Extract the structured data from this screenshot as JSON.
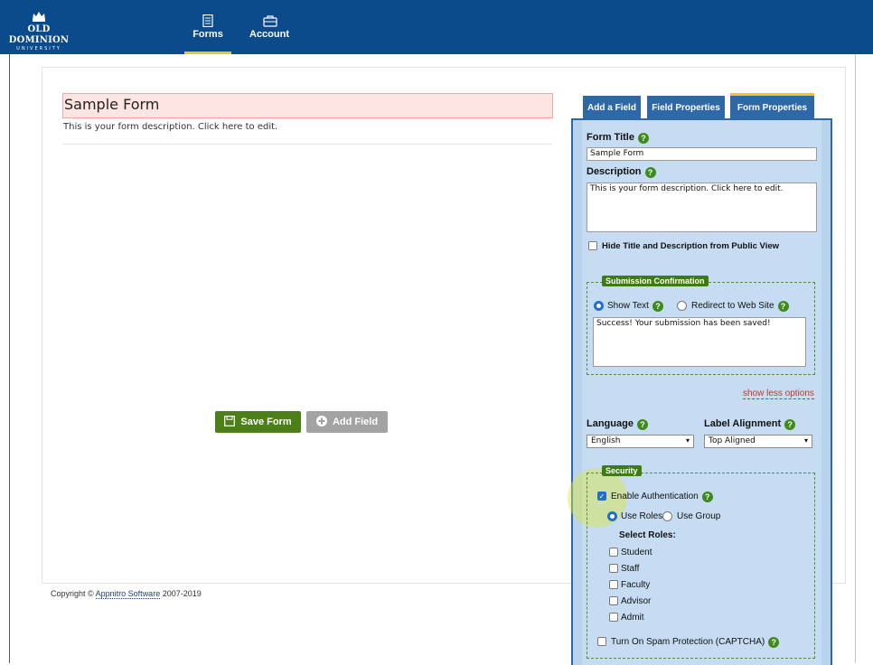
{
  "header": {
    "logo_top": "OLD DOMINION",
    "logo_bottom": "UNIVERSITY",
    "nav": [
      {
        "label": "Forms",
        "icon": "document-icon",
        "active": true
      },
      {
        "label": "Account",
        "icon": "briefcase-icon",
        "active": false
      }
    ]
  },
  "form": {
    "title": "Sample Form",
    "description": "This is your form description. Click here to edit."
  },
  "actions": {
    "save_label": "Save Form",
    "add_label": "Add Field"
  },
  "footer": {
    "prefix": "Copyright © ",
    "link": "Appnitro Software",
    "suffix": " 2007-2019"
  },
  "tabs": [
    {
      "label": "Add a Field",
      "active": false
    },
    {
      "label": "Field Properties",
      "active": false
    },
    {
      "label": "Form Properties",
      "active": true
    }
  ],
  "properties": {
    "title_label": "Form Title",
    "title_value": "Sample Form",
    "description_label": "Description",
    "description_value": "This is your form description. Click here to edit.",
    "hide_label": "Hide Title and Description from Public View",
    "confirmation": {
      "legend": "Submission Confirmation",
      "show_text": "Show Text",
      "redirect": "Redirect to Web Site",
      "message": "Success! Your submission has been saved!"
    },
    "show_less": "show less options",
    "language_label": "Language",
    "language_value": "English",
    "alignment_label": "Label Alignment",
    "alignment_value": "Top Aligned",
    "security": {
      "legend": "Security",
      "enable_auth": "Enable Authentication",
      "use_roles": "Use Roles",
      "use_group": "Use Group",
      "select_roles": "Select Roles:",
      "roles": [
        "Student",
        "Staff",
        "Faculty",
        "Advisor",
        "Admit"
      ],
      "captcha": "Turn On Spam Protection (CAPTCHA)"
    }
  },
  "colors": {
    "header": "#0b4a8b",
    "accent": "#f2c037",
    "save_button": "#4d7f18",
    "tab": "#2e68a6",
    "help": "#3f8a1c"
  }
}
